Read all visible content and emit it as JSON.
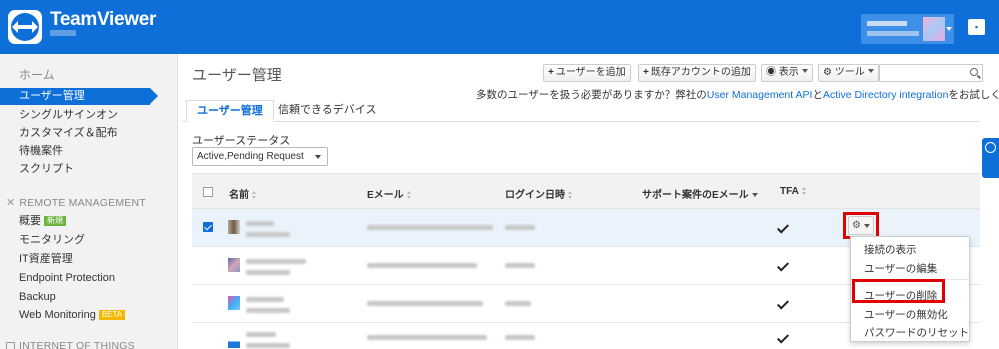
{
  "header": {
    "brand": "TeamViewer",
    "chat_icon": "chat-icon",
    "brand_color": "#0e6fd8"
  },
  "sidebar": {
    "home": "ホーム",
    "items": [
      "ユーザー管理",
      "シングルサインオン",
      "カスタマイズ＆配布",
      "待機案件",
      "スクリプト"
    ],
    "remote_section": "REMOTE MANAGEMENT",
    "remote_items": [
      "概要",
      "モニタリング",
      "IT資産管理",
      "Endpoint Protection",
      "Backup",
      "Web Monitoring"
    ],
    "badge_new": "新規",
    "badge_beta": "BETA",
    "iot_section": "INTERNET OF THINGS"
  },
  "main": {
    "title": "ユーザー管理",
    "add_user": "ユーザーを追加",
    "add_existing": "既存アカウントの追加",
    "view": "表示",
    "tools": "ツール",
    "search_placeholder": "",
    "note_prefix": "多数のユーザーを扱う必要がありますか？弊社の",
    "note_link1": "User Management API",
    "note_mid": "と",
    "note_link2": "Active Directory integration",
    "note_suffix": "をお試しください。",
    "tabs": [
      "ユーザー管理",
      "信頼できるデバイス"
    ],
    "status_label": "ユーザーステータス",
    "status_value": "Active,Pending Request"
  },
  "table": {
    "columns": [
      "名前",
      "Eメール",
      "ログイン日時",
      "サポート案件のEメール",
      "TFA"
    ],
    "rows": [
      {
        "selected": true,
        "tfa": true
      },
      {
        "selected": false,
        "tfa": true
      },
      {
        "selected": false,
        "tfa": true
      },
      {
        "selected": false,
        "tfa": true
      }
    ]
  },
  "context_menu": {
    "items": [
      "接続の表示",
      "ユーザーの編集",
      "ユーザーの削除",
      "ユーザーの無効化",
      "パスワードのリセット"
    ]
  }
}
